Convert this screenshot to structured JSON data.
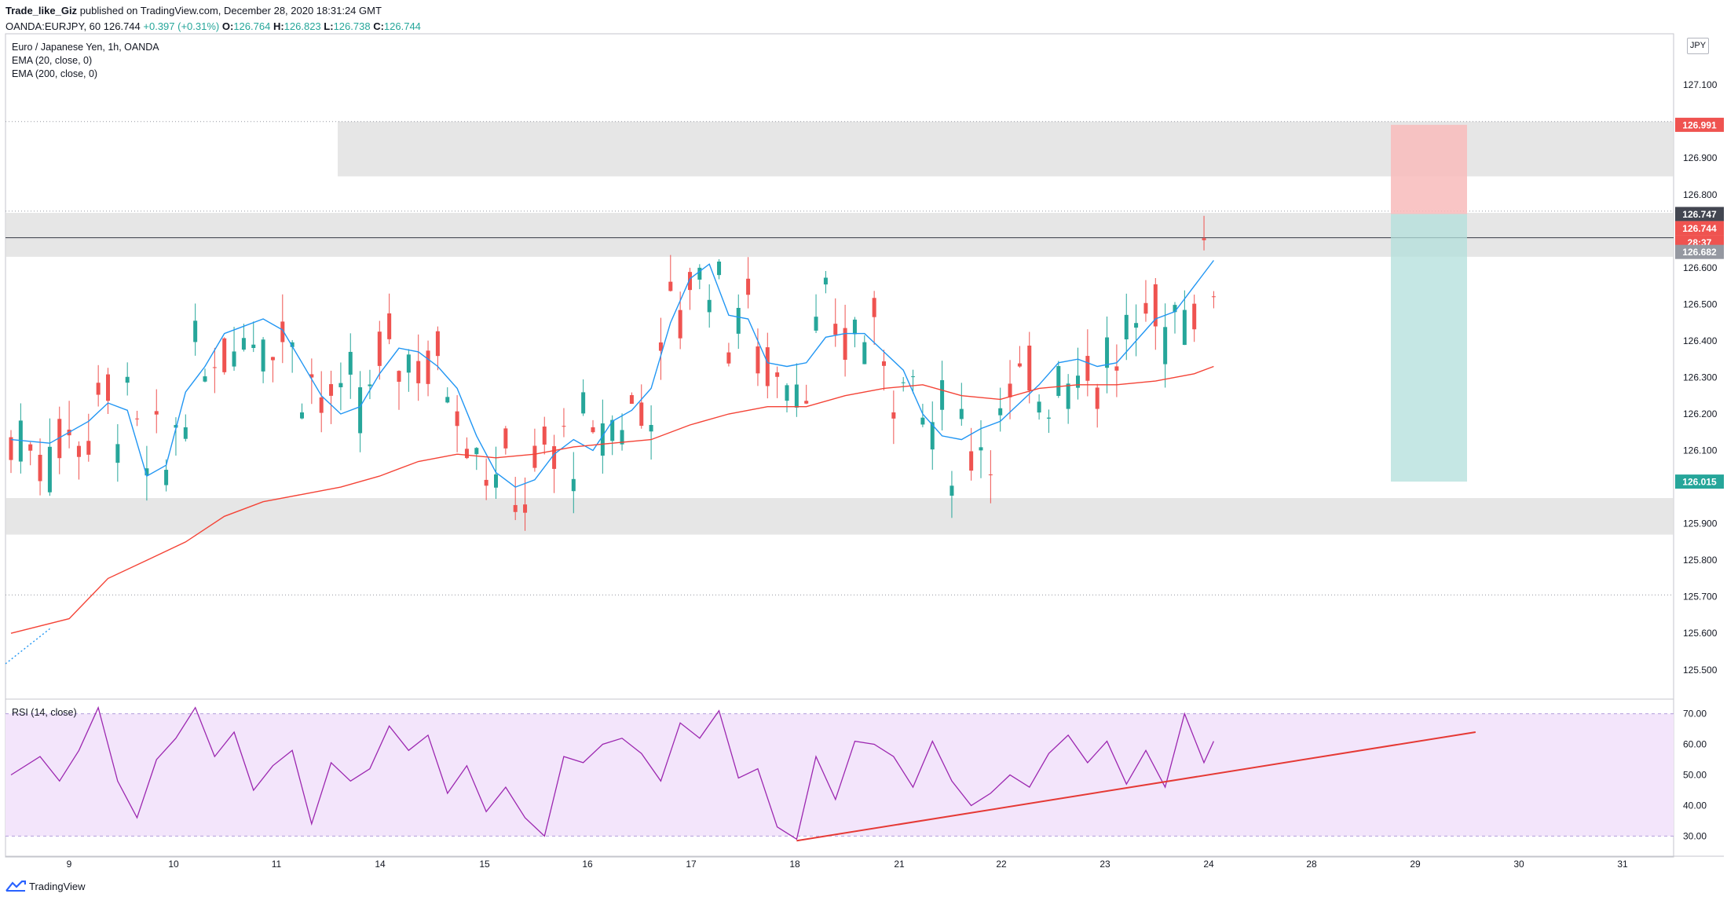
{
  "header": {
    "author": "Trade_like_Giz",
    "published": "published on TradingView.com, December 28, 2020 18:31:24 GMT",
    "symbol": "OANDA:EURJPY, 60",
    "last": "126.744",
    "change": "+0.397 (+0.31%)",
    "o_label": "O:",
    "o": "126.764",
    "h_label": "H:",
    "h": "126.823",
    "l_label": "L:",
    "l": "126.738",
    "c_label": "C:",
    "c": "126.744"
  },
  "legend": {
    "title": "Euro / Japanese Yen, 1h, OANDA",
    "ema20": "EMA (20, close, 0)",
    "ema200": "EMA (200, close, 0)",
    "rsi": "RSI (14, close)"
  },
  "currency_badge": "JPY",
  "footer": {
    "brand": "TradingView"
  },
  "colors": {
    "up": "#26a69a",
    "down": "#ef5350",
    "ema20": "#2196f3",
    "ema200": "#f44336",
    "rsi": "#9c27b0",
    "rsi_band": "#f3e5fb",
    "zone": "#e0e0e0",
    "stop": "#f8bbbb",
    "target": "#b2dfdb",
    "trendline": "#e53935"
  },
  "chart_data": [
    {
      "type": "candlestick",
      "title": "Euro / Japanese Yen, 1h, OANDA",
      "y_ticks": [
        "127.100",
        "126.900",
        "126.800",
        "126.600",
        "126.500",
        "126.400",
        "126.300",
        "126.200",
        "126.100",
        "125.900",
        "125.800",
        "125.700",
        "125.600",
        "125.500"
      ],
      "ylim": [
        125.42,
        127.24
      ],
      "x_ticks": [
        "9",
        "10",
        "11",
        "14",
        "15",
        "16",
        "17",
        "18",
        "21",
        "22",
        "23",
        "24",
        "28",
        "29",
        "30",
        "31"
      ],
      "price_labels": [
        {
          "value": "126.991",
          "role": "stop"
        },
        {
          "value": "126.747",
          "role": "entry"
        },
        {
          "value": "126.744",
          "role": "last"
        },
        {
          "value": "28:37",
          "role": "countdown"
        },
        {
          "value": "126.682",
          "role": "line"
        },
        {
          "value": "126.015",
          "role": "target"
        }
      ],
      "zones": [
        {
          "from": 126.85,
          "to": 127.0
        },
        {
          "from": 126.63,
          "to": 126.75
        },
        {
          "from": 125.87,
          "to": 125.97
        }
      ],
      "horizontal_line": 126.682,
      "dotted_levels": [
        127.0,
        126.755,
        125.705
      ],
      "position": {
        "side": "short",
        "entry": 126.747,
        "stop": 126.991,
        "target": 126.015
      },
      "series": [
        {
          "name": "EMA (20, close, 0)",
          "color": "#2196f3",
          "points": [
            [
              0,
              126.13
            ],
            [
              4,
              126.12
            ],
            [
              8,
              126.18
            ],
            [
              10,
              126.23
            ],
            [
              12,
              126.21
            ],
            [
              14,
              126.03
            ],
            [
              16,
              126.06
            ],
            [
              18,
              126.26
            ],
            [
              20,
              126.33
            ],
            [
              22,
              126.42
            ],
            [
              24,
              126.44
            ],
            [
              26,
              126.46
            ],
            [
              28,
              126.43
            ],
            [
              30,
              126.34
            ],
            [
              32,
              126.25
            ],
            [
              34,
              126.2
            ],
            [
              36,
              126.22
            ],
            [
              38,
              126.31
            ],
            [
              40,
              126.38
            ],
            [
              42,
              126.37
            ],
            [
              44,
              126.33
            ],
            [
              46,
              126.27
            ],
            [
              48,
              126.14
            ],
            [
              50,
              126.04
            ],
            [
              52,
              126.0
            ],
            [
              54,
              126.02
            ],
            [
              56,
              126.09
            ],
            [
              58,
              126.13
            ],
            [
              60,
              126.1
            ],
            [
              62,
              126.18
            ],
            [
              64,
              126.21
            ],
            [
              66,
              126.27
            ],
            [
              68,
              126.45
            ],
            [
              70,
              126.57
            ],
            [
              72,
              126.61
            ],
            [
              74,
              126.47
            ],
            [
              76,
              126.46
            ],
            [
              78,
              126.34
            ],
            [
              80,
              126.33
            ],
            [
              82,
              126.34
            ],
            [
              84,
              126.41
            ],
            [
              86,
              126.42
            ],
            [
              88,
              126.42
            ],
            [
              90,
              126.37
            ],
            [
              92,
              126.32
            ],
            [
              94,
              126.2
            ],
            [
              96,
              126.14
            ],
            [
              98,
              126.13
            ],
            [
              100,
              126.16
            ],
            [
              102,
              126.18
            ],
            [
              104,
              126.23
            ],
            [
              106,
              126.28
            ],
            [
              108,
              126.34
            ],
            [
              110,
              126.35
            ],
            [
              112,
              126.33
            ],
            [
              114,
              126.34
            ],
            [
              116,
              126.4
            ],
            [
              118,
              126.46
            ],
            [
              120,
              126.48
            ],
            [
              122,
              126.55
            ],
            [
              124,
              126.62
            ]
          ]
        },
        {
          "name": "EMA (200, close, 0)",
          "color": "#f44336",
          "points": [
            [
              0,
              125.6
            ],
            [
              6,
              125.64
            ],
            [
              10,
              125.75
            ],
            [
              14,
              125.8
            ],
            [
              18,
              125.85
            ],
            [
              22,
              125.92
            ],
            [
              26,
              125.96
            ],
            [
              30,
              125.98
            ],
            [
              34,
              126.0
            ],
            [
              38,
              126.03
            ],
            [
              42,
              126.07
            ],
            [
              46,
              126.09
            ],
            [
              50,
              126.08
            ],
            [
              54,
              126.09
            ],
            [
              58,
              126.11
            ],
            [
              62,
              126.12
            ],
            [
              66,
              126.13
            ],
            [
              70,
              126.17
            ],
            [
              74,
              126.2
            ],
            [
              78,
              126.22
            ],
            [
              82,
              126.22
            ],
            [
              86,
              126.25
            ],
            [
              90,
              126.27
            ],
            [
              94,
              126.28
            ],
            [
              98,
              126.25
            ],
            [
              102,
              126.24
            ],
            [
              106,
              126.27
            ],
            [
              110,
              126.28
            ],
            [
              114,
              126.28
            ],
            [
              118,
              126.29
            ],
            [
              122,
              126.31
            ],
            [
              124,
              126.33
            ]
          ]
        }
      ]
    },
    {
      "type": "line",
      "title": "RSI (14, close)",
      "y_ticks": [
        "70.00",
        "60.00",
        "50.00",
        "40.00",
        "30.00"
      ],
      "ylim": [
        26,
        74
      ],
      "band": [
        30,
        70
      ],
      "series": [
        {
          "name": "RSI (14, close)",
          "color": "#9c27b0",
          "points": [
            [
              0,
              50
            ],
            [
              3,
              56
            ],
            [
              5,
              48
            ],
            [
              7,
              58
            ],
            [
              9,
              72
            ],
            [
              11,
              48
            ],
            [
              13,
              36
            ],
            [
              15,
              55
            ],
            [
              17,
              62
            ],
            [
              19,
              72
            ],
            [
              21,
              56
            ],
            [
              23,
              64
            ],
            [
              25,
              45
            ],
            [
              27,
              53
            ],
            [
              29,
              58
            ],
            [
              31,
              34
            ],
            [
              33,
              54
            ],
            [
              35,
              48
            ],
            [
              37,
              52
            ],
            [
              39,
              66
            ],
            [
              41,
              58
            ],
            [
              43,
              63
            ],
            [
              45,
              44
            ],
            [
              47,
              53
            ],
            [
              49,
              38
            ],
            [
              51,
              46
            ],
            [
              53,
              36
            ],
            [
              55,
              30
            ],
            [
              57,
              56
            ],
            [
              59,
              54
            ],
            [
              61,
              60
            ],
            [
              63,
              62
            ],
            [
              65,
              57
            ],
            [
              67,
              48
            ],
            [
              69,
              67
            ],
            [
              71,
              62
            ],
            [
              73,
              71
            ],
            [
              75,
              49
            ],
            [
              77,
              52
            ],
            [
              79,
              33
            ],
            [
              81,
              29
            ],
            [
              83,
              56
            ],
            [
              85,
              42
            ],
            [
              87,
              61
            ],
            [
              89,
              60
            ],
            [
              91,
              56
            ],
            [
              93,
              46
            ],
            [
              95,
              61
            ],
            [
              97,
              48
            ],
            [
              99,
              40
            ],
            [
              101,
              44
            ],
            [
              103,
              50
            ],
            [
              105,
              46
            ],
            [
              107,
              57
            ],
            [
              109,
              63
            ],
            [
              111,
              54
            ],
            [
              113,
              61
            ],
            [
              115,
              47
            ],
            [
              117,
              58
            ],
            [
              119,
              46
            ],
            [
              121,
              70
            ],
            [
              123,
              54
            ],
            [
              124,
              61
            ]
          ]
        }
      ],
      "trendline": {
        "from": [
          81,
          28.5
        ],
        "to": [
          151,
          64
        ]
      }
    }
  ]
}
